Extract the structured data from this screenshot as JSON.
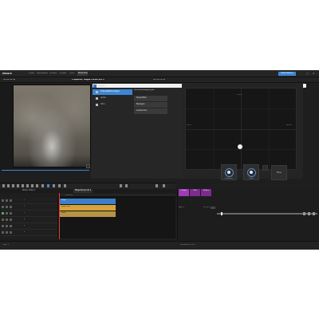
{
  "menubar": {
    "logo": "MAGIX",
    "items": [
      "Datei",
      "Bearbeiten",
      "Effekte",
      "Fenster",
      "Hilfe"
    ],
    "mode_tab": "Bearbeiten",
    "export_label": "Exportieren"
  },
  "header": {
    "left_timecode": "00:00:00:00",
    "title": "Frequenz: Magie Movie mit 1",
    "center_timecode": "00:00:12:10"
  },
  "effects": {
    "search_placeholder": "Suchen",
    "categories": [
      {
        "label": "Videoeffektvorlagen",
        "active": true
      },
      {
        "label": "Audio",
        "active": false
      },
      {
        "label": "Intro",
        "active": false
      }
    ],
    "subcategory_title": "Kamerabewegungen",
    "subitems": [
      "Stereofilter",
      "Bewegen",
      "Ausblenden"
    ]
  },
  "pan": {
    "label_top": "Vorne",
    "label_left": "Links",
    "label_right": "Rechts",
    "knobs": [
      {
        "label": "Rückseite",
        "title": ""
      },
      {
        "label": "Vorne",
        "title": "Vorne/Hinten"
      }
    ],
    "mono_label": "Mono"
  },
  "timeline": {
    "tabs": [
      "Movie: Video 1",
      "Magie Movie mit 1"
    ],
    "ruler_marker": "00:00:10",
    "tracks": [
      "1",
      "2",
      "3",
      "4",
      "5",
      "6"
    ],
    "clips": [
      {
        "label": "Regen",
        "color": "#3d7fc9"
      },
      {
        "label": "Regen.wav",
        "color": "#d9a33b"
      },
      {
        "label": "Audio",
        "color": "#c9a24a"
      }
    ]
  },
  "mixer": {
    "tabs": [
      "Loops",
      "Clips",
      "Medien"
    ],
    "track_label": "Spur 1",
    "time_label": "00:01:15"
  },
  "status": {
    "left": "Spur 1",
    "right": "Lautstärke: 100%"
  },
  "colors": {
    "accent": "#3c86d6",
    "playhead": "#e03a3a",
    "mixer_tab": "#7d2b8e"
  }
}
